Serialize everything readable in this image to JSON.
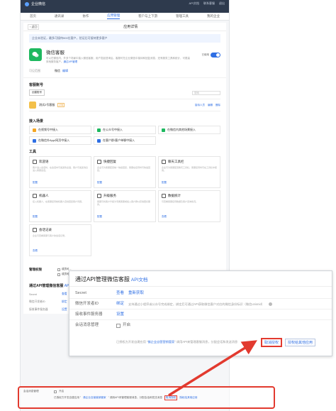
{
  "topbar": {
    "brand": "企业微信",
    "links": [
      "API文档",
      "联系客服",
      "退出"
    ]
  },
  "nav": {
    "items": [
      "首页",
      "通讯录",
      "协作",
      "应用管理",
      "客户与上下游",
      "管理工具",
      "我的企业"
    ],
    "active_index": 3
  },
  "header": {
    "back_label": "返回",
    "title": "应用详情"
  },
  "notice": {
    "text": "企业未验证，最多可接待500位客户，验证后可接待更多客户"
  },
  "app": {
    "name": "微信客服",
    "desc": "可以在微信内、外多个场景中接入微信客服，用户发起咨询后，客服可在企业微信中接待和回复消息，还有服务工具和统计，可更高效地服务客户。",
    "link_label": "通过API管理",
    "enabled_label": "已使用"
  },
  "visible": {
    "label": "可见范围",
    "value": "微信",
    "edit_label": "编辑"
  },
  "accounts": {
    "title": "客服账号",
    "create_label": "创建账号",
    "search_placeholder": "搜索",
    "rows": [
      {
        "name": "测试2号客服",
        "tag": "示例",
        "ops": [
          "接待人员",
          "编辑",
          "删除"
        ]
      }
    ]
  },
  "scenes": {
    "title": "接入场景",
    "items": [
      {
        "label": "在视频号中接入",
        "color": "#f5a623"
      },
      {
        "label": "在公众号中接入",
        "color": "#1eb85f"
      },
      {
        "label": "在微信内其他场景接入",
        "color": "#1eb85f"
      },
      {
        "label": "在微信外App/网页中接入",
        "color": "#2f6fe4"
      },
      {
        "label": "在客户群/客户单聊中接入",
        "color": "#2f6fe4"
      }
    ]
  },
  "tools": {
    "title": "工具",
    "items": [
      {
        "title": "欢迎语",
        "desc": "客户进入会话时，在会话中可发送欢迎语，客户可发送消息进入客服会话。",
        "cfg": "配置"
      },
      {
        "title": "快捷回复",
        "desc": "企业可为客服配置统一快捷回复，客服在接待时可快速回复。",
        "cfg": "配置"
      },
      {
        "title": "聊天工具栏",
        "desc": "企业可为客服配置聊天工具栏，客服接待时可在工具栏中使用。",
        "cfg": "配置"
      },
      {
        "title": "机器人",
        "desc": "接入机器人，在客服接待前机器人自动回复客户问题。",
        "cfg": "配置"
      },
      {
        "title": "升级服务",
        "desc": "客服可将客户升级为专属客服或加入客户群以获得更好服务。",
        "cfg": "配置"
      },
      {
        "title": "数据统计",
        "desc": "可查看客服接待数据及客户咨询情况。",
        "cfg": "查看"
      },
      {
        "title": "会话记录",
        "desc": "企业可查看客服与客户的会话记录。",
        "cfg": "查看"
      }
    ]
  },
  "mgmt": {
    "label": "管理权限",
    "options": [
      "成员可...",
      "成员可..."
    ]
  },
  "api_small": {
    "title": "通过API管理微信客服",
    "doc_label": "API文档",
    "secret_label": "Secret",
    "secret_view": "查看",
    "secret_refresh": "重新获取",
    "openid_label": "微信开发者ID",
    "openid_bind": "绑定",
    "openid_desc": "支持通过小程序或公众号完成绑定，绑定后可通过API获取微信客户对应的微信身份标识（微信unionid）",
    "callback_label": "接收事件服务器",
    "callback_set": "设置",
    "msg_label": "会话消息管理",
    "msg_enable": "开启",
    "msg_desc_prefix": "已授权方开发自建应用 \"",
    "msg_desc_app": "佛企业自营营销管家",
    "msg_desc_suffix": "\" 调用API来管理客服消息，分配会话和发送消息",
    "cancel_label": "取消授权",
    "other_label": "授权给其他应用"
  },
  "api_zoom": {
    "title": "通过API管理微信客服",
    "doc_label": "API文档",
    "secret_label": "Secret",
    "secret_view": "查看",
    "secret_refresh": "重新获取",
    "openid_label": "微信开发者ID",
    "openid_bind": "绑定",
    "openid_desc": "支持通过小程序或公众号完成绑定，绑定后可通过API获取微信客户对应的微信身份标识（微信unionid）",
    "callback_label": "接收事件服务器",
    "callback_set": "设置",
    "msg_label": "会话消息管理",
    "msg_enable": "开启",
    "msg_desc_prefix": "已授权方开发自建应用 \"",
    "msg_desc_app": "佛企业自营营销管家",
    "msg_desc_suffix": "\" 调用API来管理客服消息，分配会话和发送消息",
    "cancel_label": "取消授权",
    "other_label": "授权给其他应用"
  },
  "colors": {
    "accent": "#2f6fe4",
    "highlight": "#e23a2f",
    "wechat": "#1eb85f"
  }
}
